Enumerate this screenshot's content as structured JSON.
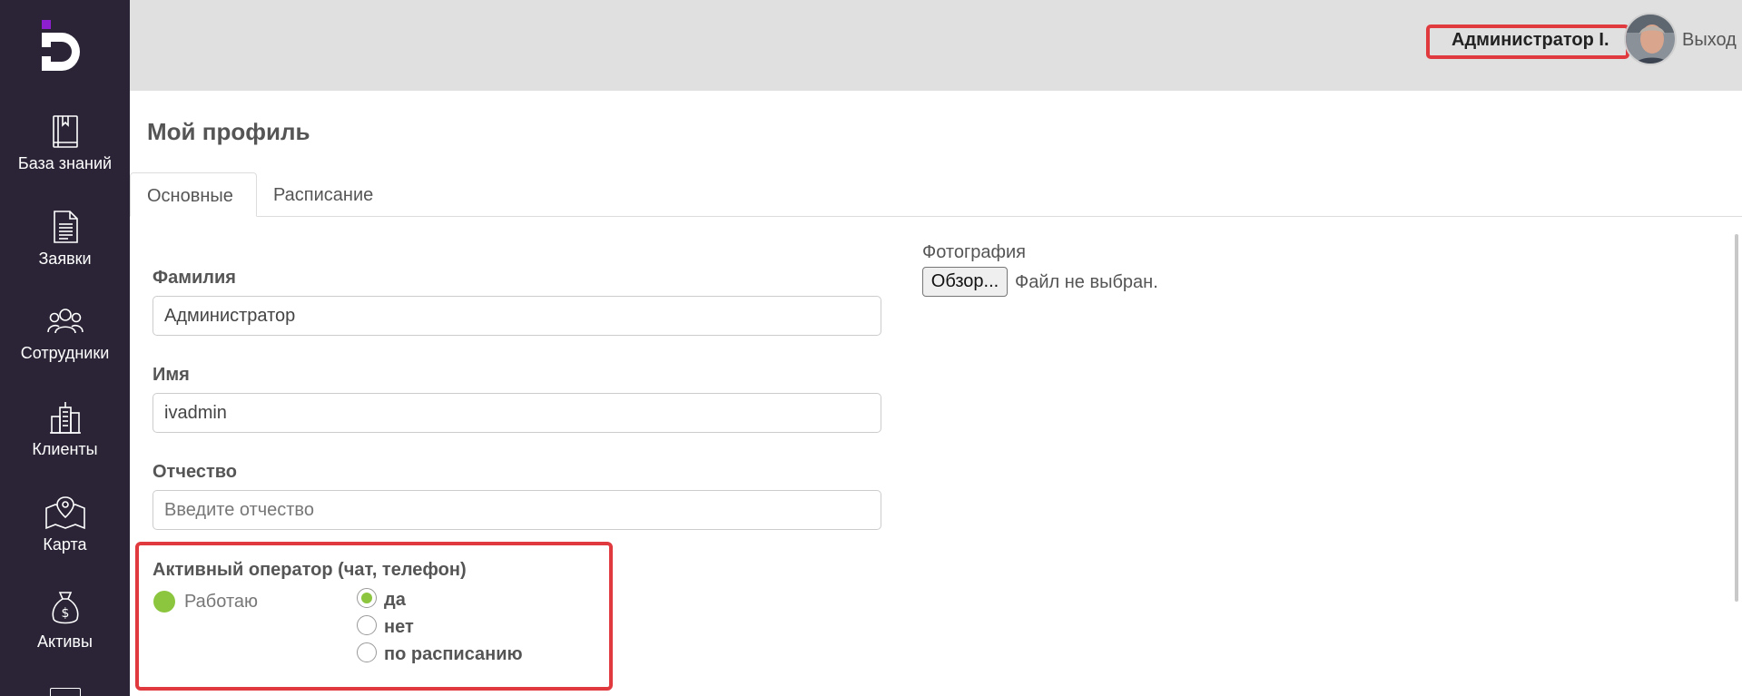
{
  "sidebar": {
    "items": [
      {
        "label": "База знаний",
        "icon": "book-icon"
      },
      {
        "label": "Заявки",
        "icon": "document-icon"
      },
      {
        "label": "Сотрудники",
        "icon": "users-icon"
      },
      {
        "label": "Клиенты",
        "icon": "buildings-icon"
      },
      {
        "label": "Карта",
        "icon": "map-icon"
      },
      {
        "label": "Активы",
        "icon": "money-bag-icon"
      }
    ]
  },
  "header": {
    "user_name": "Администратор I.",
    "logout": "Выход"
  },
  "page": {
    "title": "Мой профиль",
    "tabs": [
      {
        "label": "Основные",
        "active": true
      },
      {
        "label": "Расписание",
        "active": false
      }
    ]
  },
  "form": {
    "last_name": {
      "label": "Фамилия",
      "value": "Администратор"
    },
    "first_name": {
      "label": "Имя",
      "value": "ivadmin"
    },
    "middle_name": {
      "label": "Отчество",
      "value": "",
      "placeholder": "Введите отчество"
    },
    "photo": {
      "label": "Фотография",
      "button": "Обзор...",
      "status": "Файл не выбран."
    },
    "active_operator": {
      "label": "Активный оператор (чат, телефон)",
      "status": "Работаю",
      "status_color": "#8cc63f",
      "options": [
        "да",
        "нет",
        "по расписанию"
      ],
      "selected": "да"
    }
  },
  "colors": {
    "sidebar_bg": "#2b2436",
    "header_bg": "#e0e0e0",
    "highlight": "#e0393e",
    "logo_accent": "#8e1fd0"
  }
}
